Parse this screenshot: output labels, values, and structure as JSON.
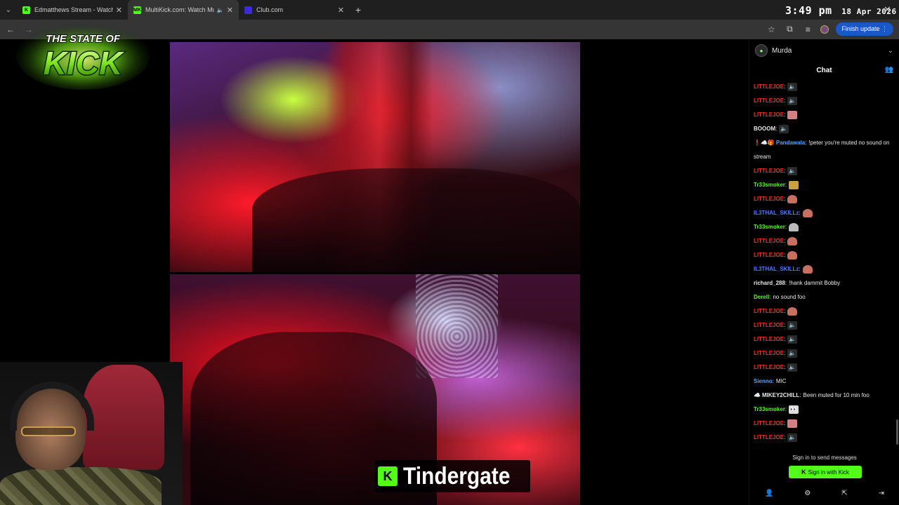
{
  "browser": {
    "tabs": [
      {
        "title": "Edmatthews Stream - Watch Li",
        "favicon_color": "#53fc18",
        "favicon_text": "K",
        "active": false
      },
      {
        "title": "MultiKick.com: Watch Multi",
        "favicon_color": "#53fc18",
        "favicon_text": "MK",
        "active": true
      },
      {
        "title": "Club.com",
        "favicon_color": "#3b2bd8",
        "favicon_text": "",
        "active": false
      }
    ],
    "finish_update_label": "Finish update"
  },
  "overlay": {
    "clock_time": "3:49 pm",
    "clock_date": "18 Apr 2026",
    "logo_line1": "THE STATE OF",
    "logo_line2": "KICK",
    "caption_badge": "K",
    "caption_text": "Tindergate"
  },
  "chat": {
    "channel_name": "Murda",
    "title": "Chat",
    "messages": [
      {
        "user": "LITTLEJOE",
        "color": "#ff2a2a",
        "emote": "speaker"
      },
      {
        "user": "LITTLEJOE",
        "color": "#ff2a2a",
        "emote": "speaker"
      },
      {
        "user": "LITTLEJOE",
        "color": "#ff2a2a",
        "emote": "face"
      },
      {
        "user": "BOOOM",
        "color": "#e8e8e8",
        "emote": "speaker"
      },
      {
        "user": "Pandawala",
        "color": "#4fa3ff",
        "badges": "❗☁️🎁",
        "text": "!peter you're muted no sound on stream"
      },
      {
        "user": "LITTLEJOE",
        "color": "#ff2a2a",
        "emote": "speaker"
      },
      {
        "user": "Tr33smoker",
        "color": "#53fc18",
        "emote": "pepe"
      },
      {
        "user": "LITTLEJOE",
        "color": "#ff2a2a",
        "emote": "hand"
      },
      {
        "user": "IL3THAL_SKILLz",
        "color": "#4f7aff",
        "emote": "hand"
      },
      {
        "user": "Tr33smoker",
        "color": "#53fc18",
        "emote": "ghost"
      },
      {
        "user": "LITTLEJOE",
        "color": "#ff2a2a",
        "emote": "hand"
      },
      {
        "user": "LITTLEJOE",
        "color": "#ff2a2a",
        "emote": "hand"
      },
      {
        "user": "IL3THAL_SKILLz",
        "color": "#4f7aff",
        "emote": "hand"
      },
      {
        "user": "richard_288",
        "color": "#e8e8e8",
        "text": "!hank dammit Bobby"
      },
      {
        "user": "Derell",
        "color": "#53fc18",
        "text": "no sound foo"
      },
      {
        "user": "LITTLEJOE",
        "color": "#ff2a2a",
        "emote": "hand"
      },
      {
        "user": "LITTLEJOE",
        "color": "#ff2a2a",
        "emote": "speaker"
      },
      {
        "user": "LITTLEJOE",
        "color": "#ff2a2a",
        "emote": "speaker"
      },
      {
        "user": "LITTLEJOE",
        "color": "#ff2a2a",
        "emote": "speaker"
      },
      {
        "user": "LITTLEJOE",
        "color": "#ff2a2a",
        "emote": "speaker"
      },
      {
        "user": "Sienno",
        "color": "#4fa3ff",
        "text": "MIC"
      },
      {
        "user": "MIKEY2CHILL",
        "color": "#e8e8e8",
        "badges": "☁️",
        "text": "Been muted for 10 min foo"
      },
      {
        "user": "Tr33smoker",
        "color": "#53fc18",
        "emote": "eyes"
      },
      {
        "user": "LITTLEJOE",
        "color": "#ff2a2a",
        "emote": "face"
      },
      {
        "user": "LITTLEJOE",
        "color": "#ff2a2a",
        "emote": "speaker"
      }
    ],
    "signin_prompt": "Sign in to send messages",
    "signin_button": "Sign in with Kick",
    "signin_button_icon": "K"
  },
  "colors": {
    "kick_green": "#53fc18",
    "update_blue": "#1a57c9"
  },
  "icons": {
    "emote_speaker": "🔈"
  }
}
